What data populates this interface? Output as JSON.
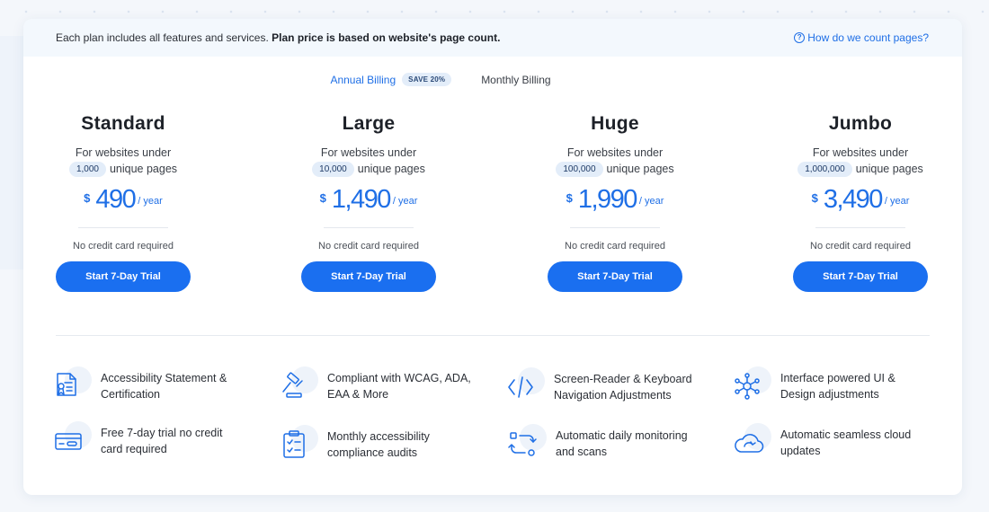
{
  "topbar": {
    "note_prefix": "Each plan includes all features and services.",
    "note_bold": "Plan price is based on website's page count.",
    "help_link": "How do we count pages?"
  },
  "billing": {
    "annual_label": "Annual Billing",
    "save_badge": "SAVE 20%",
    "monthly_label": "Monthly Billing",
    "selected": "Annual Billing"
  },
  "plans": [
    {
      "name": "Standard",
      "line1": "For websites under",
      "pages": "1,000",
      "line2": "unique pages",
      "currency": "$",
      "price": "490",
      "period": "/ year",
      "note": "No credit card required",
      "cta": "Start 7-Day Trial"
    },
    {
      "name": "Large",
      "line1": "For websites under",
      "pages": "10,000",
      "line2": "unique pages",
      "currency": "$",
      "price": "1,490",
      "period": "/ year",
      "note": "No credit card required",
      "cta": "Start 7-Day Trial"
    },
    {
      "name": "Huge",
      "line1": "For websites under",
      "pages": "100,000",
      "line2": "unique pages",
      "currency": "$",
      "price": "1,990",
      "period": "/ year",
      "note": "No credit card required",
      "cta": "Start 7-Day Trial"
    },
    {
      "name": "Jumbo",
      "line1": "For websites under",
      "pages": "1,000,000",
      "line2": "unique pages",
      "currency": "$",
      "price": "3,490",
      "period": "/ year",
      "note": "No credit card required",
      "cta": "Start 7-Day Trial"
    }
  ],
  "features": [
    {
      "icon": "certificate-icon",
      "line1": "Accessibility Statement &",
      "line2": "Certification"
    },
    {
      "icon": "gavel-icon",
      "line1": "Compliant with WCAG, ADA,",
      "line2": "EAA & More"
    },
    {
      "icon": "code-icon",
      "line1": "Screen-Reader & Keyboard",
      "line2": "Navigation Adjustments"
    },
    {
      "icon": "network-icon",
      "line1": "Interface powered UI &",
      "line2": "Design adjustments"
    },
    {
      "icon": "ticket-icon",
      "line1": "Free 7-day trial no credit",
      "line2": "card required"
    },
    {
      "icon": "checklist-icon",
      "line1": "Monthly accessibility",
      "line2": "compliance audits"
    },
    {
      "icon": "monitoring-icon",
      "line1": "Automatic daily monitoring",
      "line2": "and scans"
    },
    {
      "icon": "cloud-icon",
      "line1": "Automatic seamless cloud",
      "line2": "updates"
    }
  ],
  "colors": {
    "accent": "#1a6ff0",
    "badge_bg": "#e3edf9",
    "topbar_bg": "#f3f8fd"
  }
}
